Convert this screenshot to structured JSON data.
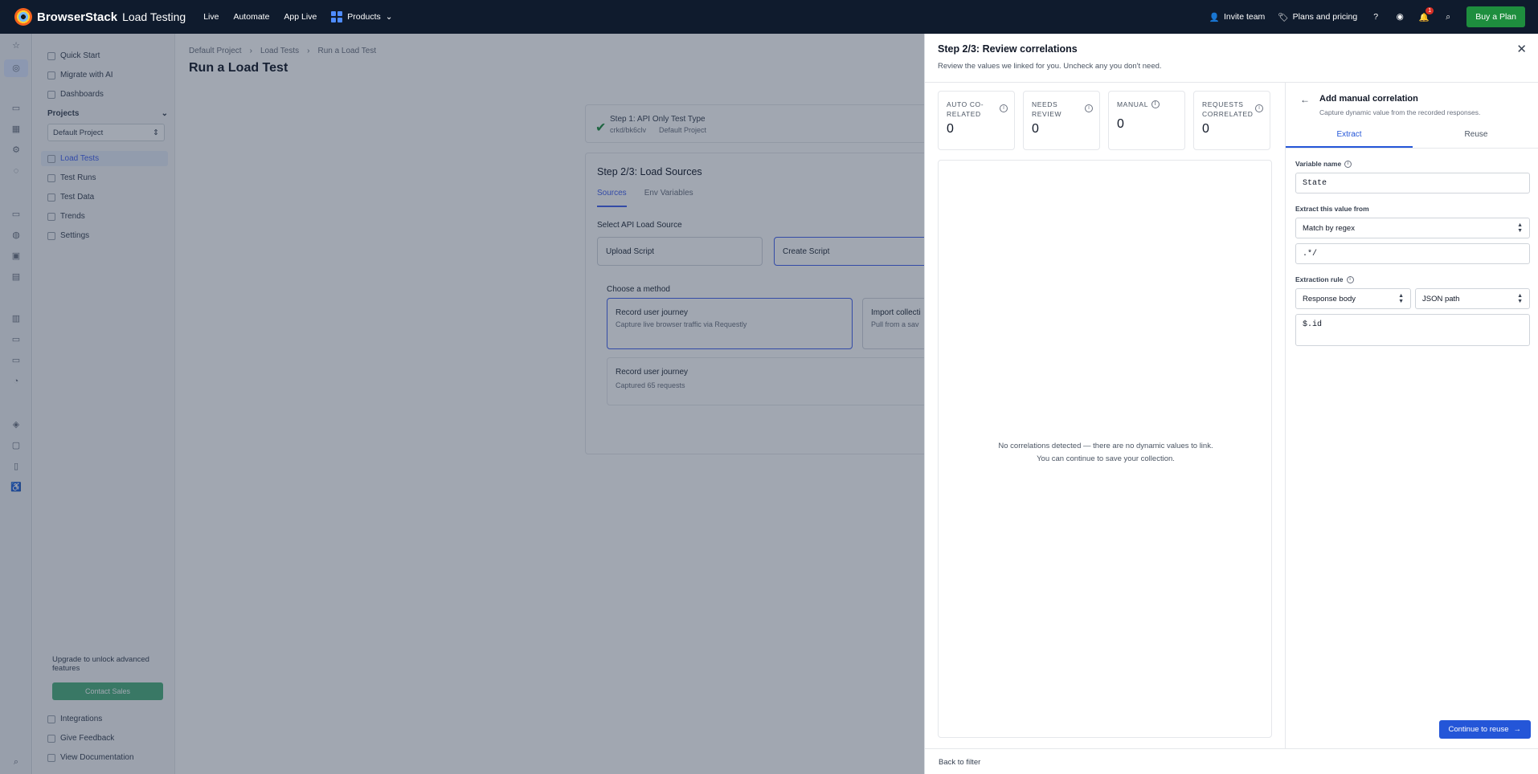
{
  "topbar": {
    "brand": "BrowserStack",
    "product": "Load Testing",
    "nav": [
      "Live",
      "Automate",
      "App Live"
    ],
    "products_label": "Products",
    "invite": "Invite team",
    "plans": "Plans and pricing",
    "notif_count": "1",
    "buy": "Buy a Plan"
  },
  "sidebar": {
    "items": [
      "Quick Start",
      "Migrate with AI",
      "Dashboards"
    ],
    "projects_label": "Projects",
    "project_select": "Default Project",
    "project_items": [
      "Load Tests",
      "Test Runs",
      "Test Data",
      "Trends",
      "Settings"
    ],
    "upgrade_text": "Upgrade to unlock advanced features",
    "contact": "Contact Sales",
    "bottom": [
      "Integrations",
      "Give Feedback",
      "View Documentation"
    ]
  },
  "main": {
    "breadcrumb": [
      "Default Project",
      "Load Tests",
      "Run a Load Test"
    ],
    "title": "Run a Load Test",
    "step1": {
      "title": "Step 1: API Only Test Type",
      "id": "crkd/bk6clv",
      "project": "Default Project"
    },
    "step2": {
      "title": "Step 2/3: Load Sources",
      "tabs": [
        "Sources",
        "Env Variables"
      ],
      "select_label": "Select API Load Source",
      "upload": "Upload Script",
      "create": "Create Script",
      "choose": "Choose a method",
      "record_title": "Record user journey",
      "record_sub": "Capture live browser traffic via Requestly",
      "import_title": "Import collecti",
      "import_sub": "Pull from a sav",
      "recorded_title": "Record user journey",
      "recorded_sub": "Captured 65 requests"
    }
  },
  "panel": {
    "title": "Step 2/3: Review correlations",
    "subtitle": "Review the values we linked for you. Uncheck any you don't need.",
    "stats": [
      {
        "label": "AUTO CO-RELATED",
        "value": "0"
      },
      {
        "label": "NEEDS REVIEW",
        "value": "0"
      },
      {
        "label": "MANUAL",
        "value": "0"
      },
      {
        "label": "REQUESTS CORRELATED",
        "value": "0"
      }
    ],
    "empty_text": "No correlations detected — there are no dynamic values to link. You can continue to save your collection.",
    "back_filter": "Back to filter"
  },
  "manual": {
    "title": "Add manual correlation",
    "subtitle": "Capture dynamic value from the recorded responses.",
    "tabs": [
      "Extract",
      "Reuse"
    ],
    "var_label": "Variable name",
    "var_value": "State",
    "extract_label": "Extract this value from",
    "extract_value": "Match by regex",
    "regex_value": ".*/",
    "rule_label": "Extraction rule",
    "rule_source": "Response body",
    "rule_type": "JSON path",
    "rule_expr": "$.id",
    "continue": "Continue to reuse"
  },
  "colors": {
    "accent": "#2456d8",
    "buy": "#1e8e3e",
    "topbar": "#0f1b2d"
  }
}
